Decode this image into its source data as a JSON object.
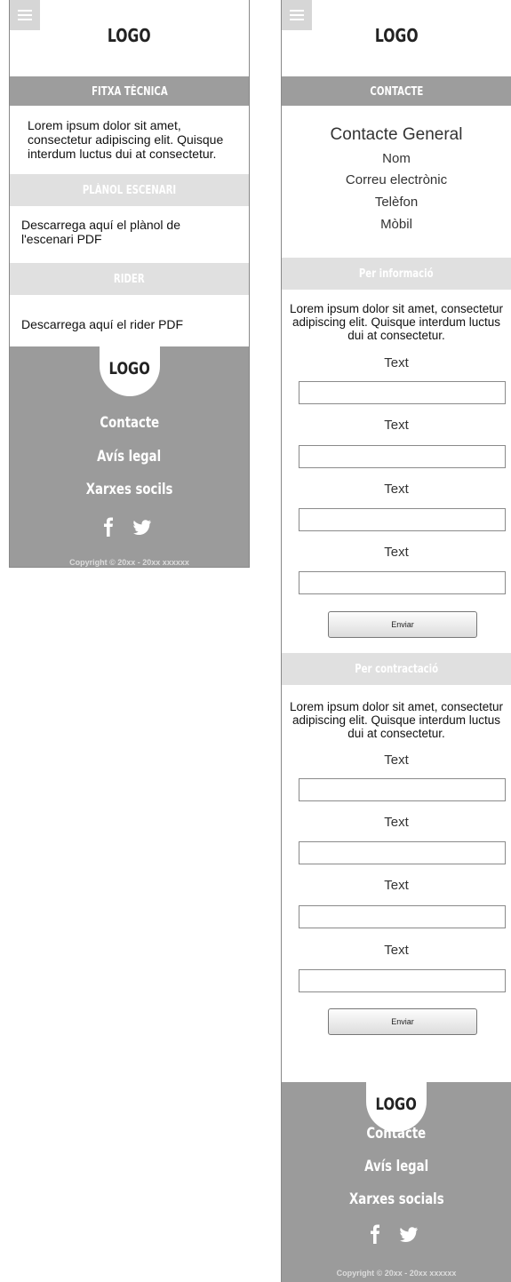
{
  "left": {
    "logo": "LOGO",
    "fitxa": {
      "title": "FITXA TÈCNICA",
      "text": "Lorem ipsum dolor sit amet, consectetur adipiscing elit. Quisque interdum luctus dui at consectetur."
    },
    "planol": {
      "title": "PLÀNOL ESCENARI",
      "text": "Descarrega aquí el plànol de l'escenari PDF"
    },
    "rider": {
      "title": "RIDER",
      "text": "Descarrega aquí el rider PDF"
    },
    "footer": {
      "logo": "LOGO",
      "links": [
        "Contacte",
        "Avís legal",
        "Xarxes socils"
      ],
      "icons": [
        "facebook-icon",
        "twitter-icon"
      ],
      "copyright": "Copyright © 20xx - 20xx xxxxxx"
    }
  },
  "right": {
    "logo": "LOGO",
    "contacte": {
      "title": "CONTACTE",
      "heading": "Contacte General",
      "items": [
        "Nom",
        "Correu electrònic",
        "Telèfon",
        "Mòbil"
      ]
    },
    "informacio": {
      "title": "Per informació",
      "text": "Lorem ipsum dolor sit amet, consectetur adipiscing elit. Quisque interdum luctus dui at consectetur.",
      "fields": [
        "Text",
        "Text",
        "Text",
        "Text"
      ],
      "button": "Enviar"
    },
    "contractacio": {
      "title": "Per contractació",
      "text": "Lorem ipsum dolor sit amet, consectetur adipiscing elit. Quisque interdum luctus dui at consectetur.",
      "fields": [
        "Text",
        "Text",
        "Text",
        "Text"
      ],
      "button": "Enviar"
    },
    "footer": {
      "logo": "LOGO",
      "links": [
        "Contacte",
        "Avís legal",
        "Xarxes socials"
      ],
      "icons": [
        "facebook-icon",
        "twitter-icon"
      ],
      "copyright": "Copyright © 20xx - 20xx xxxxxx"
    }
  },
  "colors": {
    "band_dark": "#9d9d9d",
    "band_light": "#e0e0e0",
    "footer": "#9b9b9b"
  }
}
